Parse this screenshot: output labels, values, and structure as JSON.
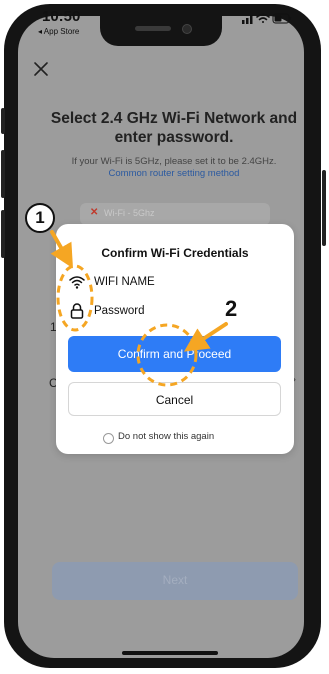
{
  "status_bar": {
    "time": "10:50",
    "back_label": "◂ App Store",
    "icons": [
      "signal-icon",
      "wifi-icon",
      "battery-icon"
    ]
  },
  "background": {
    "title": "Select 2.4 GHz Wi-Fi Network and enter password.",
    "subtitle": "If your Wi-Fi is 5GHz, please set it to be 2.4GHz.",
    "router_link": "Common router setting method",
    "wifi_field": "Wi-Fi - 5Ghz",
    "next_button": "Next"
  },
  "dialog": {
    "title": "Confirm Wi-Fi Credentials",
    "wifi_name": "WIFI NAME",
    "password": "Password",
    "confirm_button": "Confirm and Proceed",
    "cancel_button": "Cancel",
    "do_not_show": "Do not show this again"
  },
  "annotations": {
    "step1": "1",
    "step2": "2",
    "marker_color": "#f5a623"
  },
  "colors": {
    "primary": "#2e7cf6",
    "overlay": "#9c9c9c",
    "error": "#c0392b",
    "link": "#2c5aa0"
  }
}
